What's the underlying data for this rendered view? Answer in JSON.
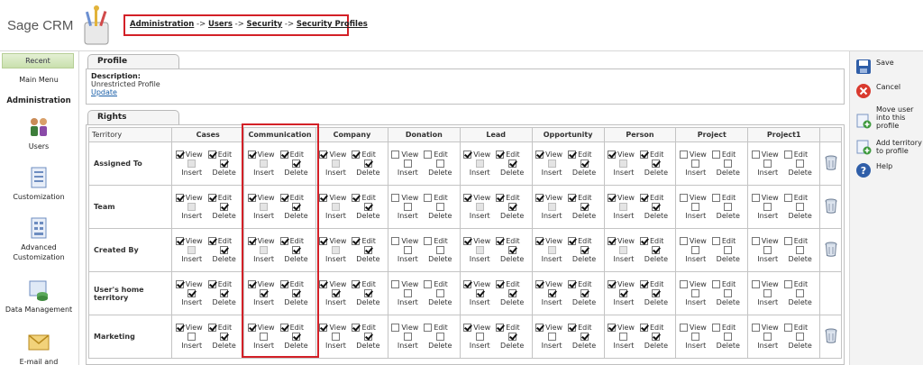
{
  "app": {
    "name": "Sage CRM"
  },
  "breadcrumb": [
    {
      "label": "Administration"
    },
    {
      "label": "Users"
    },
    {
      "label": "Security"
    },
    {
      "label": "Security Profiles"
    }
  ],
  "breadcrumb_sep": "->",
  "sidebar": {
    "recent": "Recent",
    "main_menu": "Main Menu",
    "section": "Administration",
    "items": [
      {
        "label": "Users",
        "icon": "users-icon"
      },
      {
        "label": "Customization",
        "icon": "customization-icon"
      },
      {
        "label": "Advanced Customization",
        "icon": "advanced-customization-icon"
      },
      {
        "label": "Data Management",
        "icon": "data-management-icon"
      },
      {
        "label": "E-mail and",
        "icon": "email-icon"
      }
    ]
  },
  "profile": {
    "tab": "Profile",
    "description_label": "Description:",
    "description_value": "Unrestricted Profile",
    "update_link": "Update"
  },
  "rights": {
    "tab": "Rights",
    "territory_header": "Territory",
    "entities": [
      "Cases",
      "Communication",
      "Company",
      "Donation",
      "Lead",
      "Opportunity",
      "Person",
      "Project",
      "Project1"
    ],
    "labels": {
      "view": "View",
      "edit": "Edit",
      "insert": "Insert",
      "delete": "Delete"
    },
    "rows": [
      {
        "territory": "Assigned To",
        "has_delete_icon": true,
        "perms": [
          {
            "view": true,
            "edit": true,
            "insert": false,
            "insert_disabled": true,
            "delete": true
          },
          {
            "view": true,
            "edit": true,
            "insert": false,
            "insert_disabled": true,
            "delete": true
          },
          {
            "view": true,
            "edit": true,
            "insert": false,
            "insert_disabled": true,
            "delete": true
          },
          {
            "view": false,
            "edit": false,
            "insert": false,
            "insert_disabled": false,
            "delete": false
          },
          {
            "view": true,
            "edit": true,
            "insert": false,
            "insert_disabled": true,
            "delete": true
          },
          {
            "view": true,
            "edit": true,
            "insert": false,
            "insert_disabled": true,
            "delete": true
          },
          {
            "view": true,
            "edit": true,
            "insert": false,
            "insert_disabled": true,
            "delete": true
          },
          {
            "view": false,
            "edit": false,
            "insert": false,
            "insert_disabled": false,
            "delete": false
          },
          {
            "view": false,
            "edit": false,
            "insert": false,
            "insert_disabled": false,
            "delete": false
          }
        ]
      },
      {
        "territory": "Team",
        "has_delete_icon": true,
        "perms": [
          {
            "view": true,
            "edit": true,
            "insert": false,
            "insert_disabled": true,
            "delete": true
          },
          {
            "view": true,
            "edit": true,
            "insert": false,
            "insert_disabled": true,
            "delete": true
          },
          {
            "view": true,
            "edit": true,
            "insert": false,
            "insert_disabled": true,
            "delete": true
          },
          {
            "view": false,
            "edit": false,
            "insert": false,
            "insert_disabled": false,
            "delete": false
          },
          {
            "view": true,
            "edit": true,
            "insert": false,
            "insert_disabled": true,
            "delete": true
          },
          {
            "view": true,
            "edit": true,
            "insert": false,
            "insert_disabled": true,
            "delete": true
          },
          {
            "view": true,
            "edit": true,
            "insert": false,
            "insert_disabled": true,
            "delete": true
          },
          {
            "view": false,
            "edit": false,
            "insert": false,
            "insert_disabled": false,
            "delete": false
          },
          {
            "view": false,
            "edit": false,
            "insert": false,
            "insert_disabled": false,
            "delete": false
          }
        ]
      },
      {
        "territory": "Created By",
        "has_delete_icon": true,
        "perms": [
          {
            "view": true,
            "edit": true,
            "insert": false,
            "insert_disabled": true,
            "delete": true
          },
          {
            "view": true,
            "edit": true,
            "insert": false,
            "insert_disabled": true,
            "delete": true
          },
          {
            "view": true,
            "edit": true,
            "insert": false,
            "insert_disabled": true,
            "delete": true
          },
          {
            "view": false,
            "edit": false,
            "insert": false,
            "insert_disabled": false,
            "delete": false
          },
          {
            "view": true,
            "edit": true,
            "insert": false,
            "insert_disabled": true,
            "delete": true
          },
          {
            "view": true,
            "edit": true,
            "insert": false,
            "insert_disabled": true,
            "delete": true
          },
          {
            "view": true,
            "edit": true,
            "insert": false,
            "insert_disabled": true,
            "delete": true
          },
          {
            "view": false,
            "edit": false,
            "insert": false,
            "insert_disabled": false,
            "delete": false
          },
          {
            "view": false,
            "edit": false,
            "insert": false,
            "insert_disabled": false,
            "delete": false
          }
        ]
      },
      {
        "territory": "User's home territory",
        "has_delete_icon": false,
        "perms": [
          {
            "view": true,
            "edit": true,
            "insert": true,
            "insert_disabled": false,
            "delete": true
          },
          {
            "view": true,
            "edit": true,
            "insert": true,
            "insert_disabled": false,
            "delete": true
          },
          {
            "view": true,
            "edit": true,
            "insert": true,
            "insert_disabled": false,
            "delete": true
          },
          {
            "view": false,
            "edit": false,
            "insert": false,
            "insert_disabled": false,
            "delete": false
          },
          {
            "view": true,
            "edit": true,
            "insert": true,
            "insert_disabled": false,
            "delete": true
          },
          {
            "view": true,
            "edit": true,
            "insert": true,
            "insert_disabled": false,
            "delete": true
          },
          {
            "view": true,
            "edit": true,
            "insert": true,
            "insert_disabled": false,
            "delete": true
          },
          {
            "view": false,
            "edit": false,
            "insert": false,
            "insert_disabled": false,
            "delete": false
          },
          {
            "view": false,
            "edit": false,
            "insert": false,
            "insert_disabled": false,
            "delete": false
          }
        ]
      },
      {
        "territory": "Marketing",
        "has_delete_icon": true,
        "perms": [
          {
            "view": true,
            "edit": true,
            "insert": false,
            "insert_disabled": false,
            "delete": true
          },
          {
            "view": true,
            "edit": true,
            "insert": false,
            "insert_disabled": false,
            "delete": true
          },
          {
            "view": true,
            "edit": true,
            "insert": false,
            "insert_disabled": false,
            "delete": true
          },
          {
            "view": false,
            "edit": false,
            "insert": false,
            "insert_disabled": false,
            "delete": false
          },
          {
            "view": true,
            "edit": true,
            "insert": false,
            "insert_disabled": false,
            "delete": true
          },
          {
            "view": true,
            "edit": true,
            "insert": false,
            "insert_disabled": false,
            "delete": true
          },
          {
            "view": true,
            "edit": true,
            "insert": false,
            "insert_disabled": false,
            "delete": true
          },
          {
            "view": false,
            "edit": false,
            "insert": false,
            "insert_disabled": false,
            "delete": false
          },
          {
            "view": false,
            "edit": false,
            "insert": false,
            "insert_disabled": false,
            "delete": false
          }
        ]
      }
    ]
  },
  "actions": [
    {
      "label": "Save",
      "icon": "save-icon"
    },
    {
      "label": "Cancel",
      "icon": "cancel-icon"
    },
    {
      "label": "Move user into this profile",
      "icon": "move-user-icon"
    },
    {
      "label": "Add territory to profile",
      "icon": "add-territory-icon"
    },
    {
      "label": "Help",
      "icon": "help-icon"
    }
  ],
  "colors": {
    "highlight": "#d32027",
    "sidebar_recent": "#c9e0ad",
    "link": "#1a5fa8"
  }
}
